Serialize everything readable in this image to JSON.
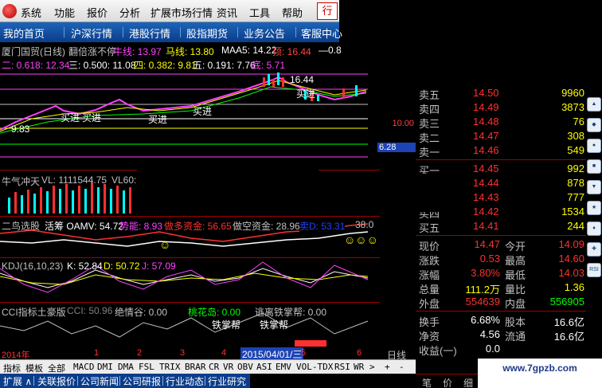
{
  "menubar": {
    "items": [
      "系统",
      "功能",
      "报价",
      "分析",
      "扩展市场行情",
      "资讯",
      "工具",
      "帮助"
    ],
    "trade": "行"
  },
  "navbar": {
    "items": [
      "我的首页",
      "沪深行情",
      "港股行情",
      "股指期货",
      "业务公告",
      "客服中心"
    ]
  },
  "main_pane": {
    "title": "厦门国贸(日线)",
    "indicator": "翻倍涨不停",
    "values": [
      "牛线: 13.97",
      "马线: 13.80",
      "MAA5: 14.22",
      "顶: 16.44",
      "—0.8"
    ],
    "row2": [
      "二: 0.618: 12.34",
      "三: 0.500: 11.08",
      "四: 0.382: 9.81",
      "五: 0.191: 7.76",
      "底: 5.71"
    ],
    "annotations": {
      "high": "16.44",
      "low": "9.83",
      "buy1": "买进",
      "buy2": "买进",
      "buy3": "买进",
      "buy4": "买进",
      "buy5": "买进"
    },
    "price_tag": "6.28",
    "axis_ten": "10.00",
    "colors": {
      "up": "#ff3030",
      "down": "#00ffff",
      "ma1": "#ff40ff",
      "ma2": "#ffff00"
    }
  },
  "vol_pane": {
    "title": "牛气冲天",
    "vl": "VL: 1111544.75",
    "vl60": "VL60: 1"
  },
  "bird_pane": {
    "title": "二鸟选股",
    "active": "活筹 OAMV: 54.72",
    "strong": "势能: 8.93",
    "bull": "做多资金: 56.65",
    "bear": "做空资金: 28.96",
    "sell": "卖D: 53.31",
    "tail": "38.0"
  },
  "kdj_pane": {
    "title": "KDJ(16,10,23)",
    "k": "K: 52.84",
    "d": "D: 50.72",
    "j": "J: 57.09"
  },
  "cci_pane": {
    "title": "CCI指标土豪版",
    "cci": "CCI: 50.96",
    "jq": "绝情谷: 0.00",
    "th": "桃花岛: 0.00",
    "tl": "逃离铁掌帮: 0.00",
    "tz1": "铁掌帮",
    "tz2": "铁掌帮"
  },
  "timeline": {
    "year": "2014年",
    "ticks": [
      "1",
      "2",
      "3",
      "4",
      "5",
      "6"
    ],
    "date": "2015/04/01/三",
    "period": "日线"
  },
  "quote": {
    "asks": [
      {
        "name": "卖五",
        "price": "14.50",
        "vol": "9960"
      },
      {
        "name": "卖四",
        "price": "14.49",
        "vol": "3873"
      },
      {
        "name": "卖三",
        "price": "14.48",
        "vol": "76"
      },
      {
        "name": "卖二",
        "price": "14.47",
        "vol": "308"
      },
      {
        "name": "卖一",
        "price": "14.46",
        "vol": "549"
      }
    ],
    "bids": [
      {
        "name": "买一",
        "price": "14.45",
        "vol": "992"
      },
      {
        "name": "买二",
        "price": "14.44",
        "vol": "878"
      },
      {
        "name": "买三",
        "price": "14.43",
        "vol": "777"
      },
      {
        "name": "买四",
        "price": "14.42",
        "vol": "1534"
      },
      {
        "name": "买五",
        "price": "14.41",
        "vol": "244"
      }
    ],
    "stats": [
      {
        "l1": "现价",
        "v1": "14.47",
        "l2": "今开",
        "v2": "14.09"
      },
      {
        "l1": "涨跌",
        "v1": "0.53",
        "l2": "最高",
        "v2": "14.60"
      },
      {
        "l1": "涨幅",
        "v1": "3.80%",
        "l2": "最低",
        "v2": "14.03"
      },
      {
        "l1": "总量",
        "v1": "111.2万",
        "l2": "量比",
        "v2": "1.36"
      },
      {
        "l1": "外盘",
        "v1": "554639",
        "l2": "内盘",
        "v2": "556905"
      }
    ],
    "fin": [
      {
        "l1": "换手",
        "v1": "6.68%",
        "l2": "股本",
        "v2": "16.6亿"
      },
      {
        "l1": "净资",
        "v1": "4.56",
        "l2": "流通",
        "v2": "16.6亿"
      },
      {
        "l1": "收益(一)",
        "v1": "0.0",
        "l2": "",
        "v2": ""
      }
    ],
    "bottom": [
      "笔",
      "价",
      "细"
    ]
  },
  "side_tools": [
    "icon1",
    "icon2",
    "icon3",
    "icon4",
    "icon5",
    "icon6",
    "icon7",
    "icon8",
    "RSI"
  ],
  "indbar": [
    "指标",
    "模板",
    "全部",
    "MACD",
    "DMI",
    "DMA",
    "FSL",
    "TRIX",
    "BRAR",
    "CR",
    "VR",
    "OBV",
    "ASI",
    "EMV",
    "VOL-TDX",
    "RSI",
    "WR",
    ">",
    "+",
    "-"
  ],
  "tabbar": [
    "扩展 ∧",
    "关联报价",
    "公司新闻",
    "公司研报",
    "行业动态",
    "行业研究"
  ],
  "watermark": "www.7gpzb.com"
}
